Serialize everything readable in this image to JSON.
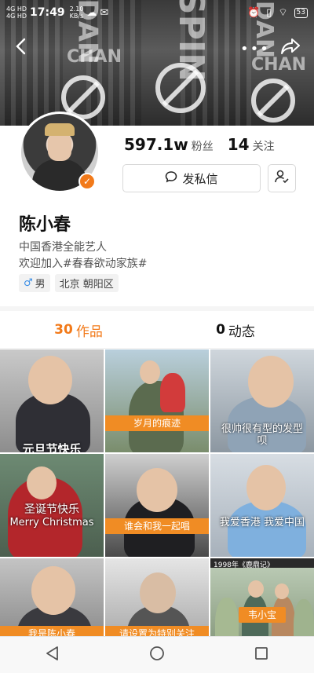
{
  "status_bar": {
    "signal": "4G HD\n4G HD",
    "time": "17:49",
    "speed": "2.10\nKB/s",
    "battery": "53"
  },
  "header": {
    "more_icon": "more-dots-icon",
    "back_icon": "back-arrow-icon",
    "share_icon": "share-icon"
  },
  "profile": {
    "followers_count": "597.1w",
    "followers_label": "粉丝",
    "following_count": "14",
    "following_label": "关注",
    "message_button": "发私信",
    "name": "陈小春",
    "description": "中国香港全能艺人",
    "bio": "欢迎加入#春春欲动家族#",
    "gender_symbol": "♂",
    "gender": "男",
    "location": "北京 朝阳区"
  },
  "tabs": [
    {
      "count": "30",
      "label": "作品",
      "active": true
    },
    {
      "count": "0",
      "label": "动态",
      "active": false
    }
  ],
  "videos": [
    {
      "caption": "元旦节快乐"
    },
    {
      "caption": "岁月的痕迹"
    },
    {
      "caption": "很帅很有型的发型呗"
    },
    {
      "caption": "圣诞节快乐",
      "caption2": "Merry Christmas"
    },
    {
      "caption": "谁会和我一起唱"
    },
    {
      "caption": "我爱香港 我爱中国"
    },
    {
      "caption": "我是陈小春"
    },
    {
      "caption": "请设置为特别关注"
    },
    {
      "caption": "韦小宝",
      "top_text": "1998年《鹿鼎记》"
    }
  ],
  "colors": {
    "accent": "#f27a1a",
    "caption_bg": "#f08c24"
  }
}
